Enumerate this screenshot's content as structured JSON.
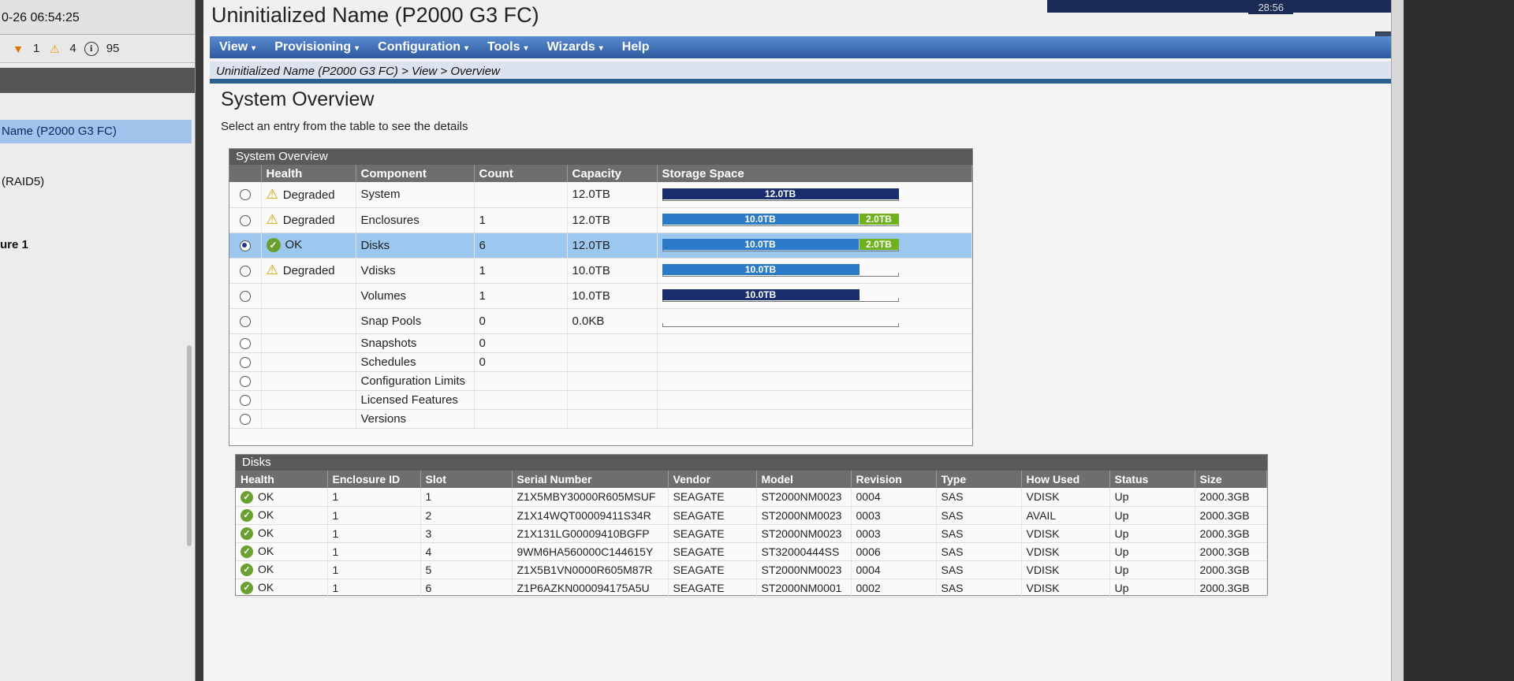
{
  "sidebar": {
    "time": "0-26 06:54:25",
    "alerts": {
      "critical": "1",
      "warning": "4",
      "info": "95"
    },
    "tree": [
      {
        "label": "Name (P2000 G3 FC)",
        "selected": true
      },
      {
        "label": "(RAID5)"
      },
      {
        "label": "ure 1"
      }
    ]
  },
  "header": {
    "title": "Uninitialized Name (P2000 G3 FC)",
    "clock": "28:56",
    "help_label": "?"
  },
  "menu": [
    {
      "label": "View",
      "caret": "▾"
    },
    {
      "label": "Provisioning",
      "caret": "▾"
    },
    {
      "label": "Configuration",
      "caret": "▾"
    },
    {
      "label": "Tools",
      "caret": "▾"
    },
    {
      "label": "Wizards",
      "caret": "▾"
    },
    {
      "label": "Help",
      "caret": ""
    }
  ],
  "breadcrumb": "Uninitialized Name (P2000 G3 FC) > View > Overview",
  "page": {
    "title": "System Overview",
    "subtitle": "Select an entry from the table to see the details"
  },
  "overview": {
    "panel_title": "System Overview",
    "columns": [
      "Health",
      "Component",
      "Count",
      "Capacity",
      "Storage Space"
    ],
    "rows": [
      {
        "health": "Degraded",
        "health_icon": "warning-icon",
        "component": "System",
        "count": "",
        "capacity": "12.0TB",
        "bars": [
          {
            "label": "12.0TB",
            "frac": 1.0,
            "color": "navy"
          }
        ],
        "selected": false
      },
      {
        "health": "Degraded",
        "health_icon": "warning-icon",
        "component": "Enclosures",
        "count": "1",
        "capacity": "12.0TB",
        "bars": [
          {
            "label": "10.0TB",
            "frac": 0.833,
            "color": "blue"
          },
          {
            "label": "2.0TB",
            "frac": 0.167,
            "color": "green"
          }
        ],
        "selected": false
      },
      {
        "health": "OK",
        "health_icon": "ok-icon",
        "component": "Disks",
        "count": "6",
        "capacity": "12.0TB",
        "bars": [
          {
            "label": "10.0TB",
            "frac": 0.833,
            "color": "blue"
          },
          {
            "label": "2.0TB",
            "frac": 0.167,
            "color": "green"
          }
        ],
        "selected": true
      },
      {
        "health": "Degraded",
        "health_icon": "warning-icon",
        "component": "Vdisks",
        "count": "1",
        "capacity": "10.0TB",
        "bars": [
          {
            "label": "10.0TB",
            "frac": 0.833,
            "color": "blue"
          }
        ],
        "selected": false
      },
      {
        "health": "",
        "health_icon": "",
        "component": "Volumes",
        "count": "1",
        "capacity": "10.0TB",
        "bars": [
          {
            "label": "10.0TB",
            "frac": 0.833,
            "color": "navy"
          }
        ],
        "selected": false
      },
      {
        "health": "",
        "health_icon": "",
        "component": "Snap Pools",
        "count": "0",
        "capacity": "0.0KB",
        "bars": [],
        "track": true,
        "selected": false
      },
      {
        "health": "",
        "health_icon": "",
        "component": "Snapshots",
        "count": "0",
        "capacity": "",
        "bars": [],
        "selected": false,
        "small": true
      },
      {
        "health": "",
        "health_icon": "",
        "component": "Schedules",
        "count": "0",
        "capacity": "",
        "bars": [],
        "selected": false,
        "small": true
      },
      {
        "health": "",
        "health_icon": "",
        "component": "Configuration Limits",
        "count": "",
        "capacity": "",
        "bars": [],
        "selected": false,
        "small": true
      },
      {
        "health": "",
        "health_icon": "",
        "component": "Licensed Features",
        "count": "",
        "capacity": "",
        "bars": [],
        "selected": false,
        "small": true
      },
      {
        "health": "",
        "health_icon": "",
        "component": "Versions",
        "count": "",
        "capacity": "",
        "bars": [],
        "selected": false,
        "small": true
      }
    ]
  },
  "disks": {
    "panel_title": "Disks",
    "columns": [
      "Health",
      "Enclosure ID",
      "Slot",
      "Serial Number",
      "Vendor",
      "Model",
      "Revision",
      "Type",
      "How Used",
      "Status",
      "Size"
    ],
    "rows": [
      [
        "OK",
        "1",
        "1",
        "Z1X5MBY30000R605MSUF",
        "SEAGATE",
        "ST2000NM0023",
        "0004",
        "SAS",
        "VDISK",
        "Up",
        "2000.3GB"
      ],
      [
        "OK",
        "1",
        "2",
        "Z1X14WQT00009411S34R",
        "SEAGATE",
        "ST2000NM0023",
        "0003",
        "SAS",
        "AVAIL",
        "Up",
        "2000.3GB"
      ],
      [
        "OK",
        "1",
        "3",
        "Z1X131LG00009410BGFP",
        "SEAGATE",
        "ST2000NM0023",
        "0003",
        "SAS",
        "VDISK",
        "Up",
        "2000.3GB"
      ],
      [
        "OK",
        "1",
        "4",
        "9WM6HA560000C144615Y",
        "SEAGATE",
        "ST32000444SS",
        "0006",
        "SAS",
        "VDISK",
        "Up",
        "2000.3GB"
      ],
      [
        "OK",
        "1",
        "5",
        "Z1X5B1VN0000R605M87R",
        "SEAGATE",
        "ST2000NM0023",
        "0004",
        "SAS",
        "VDISK",
        "Up",
        "2000.3GB"
      ],
      [
        "OK",
        "1",
        "6",
        "Z1P6AZKN000094175A5U",
        "SEAGATE",
        "ST2000NM0001",
        "0002",
        "SAS",
        "VDISK",
        "Up",
        "2000.3GB"
      ]
    ]
  }
}
